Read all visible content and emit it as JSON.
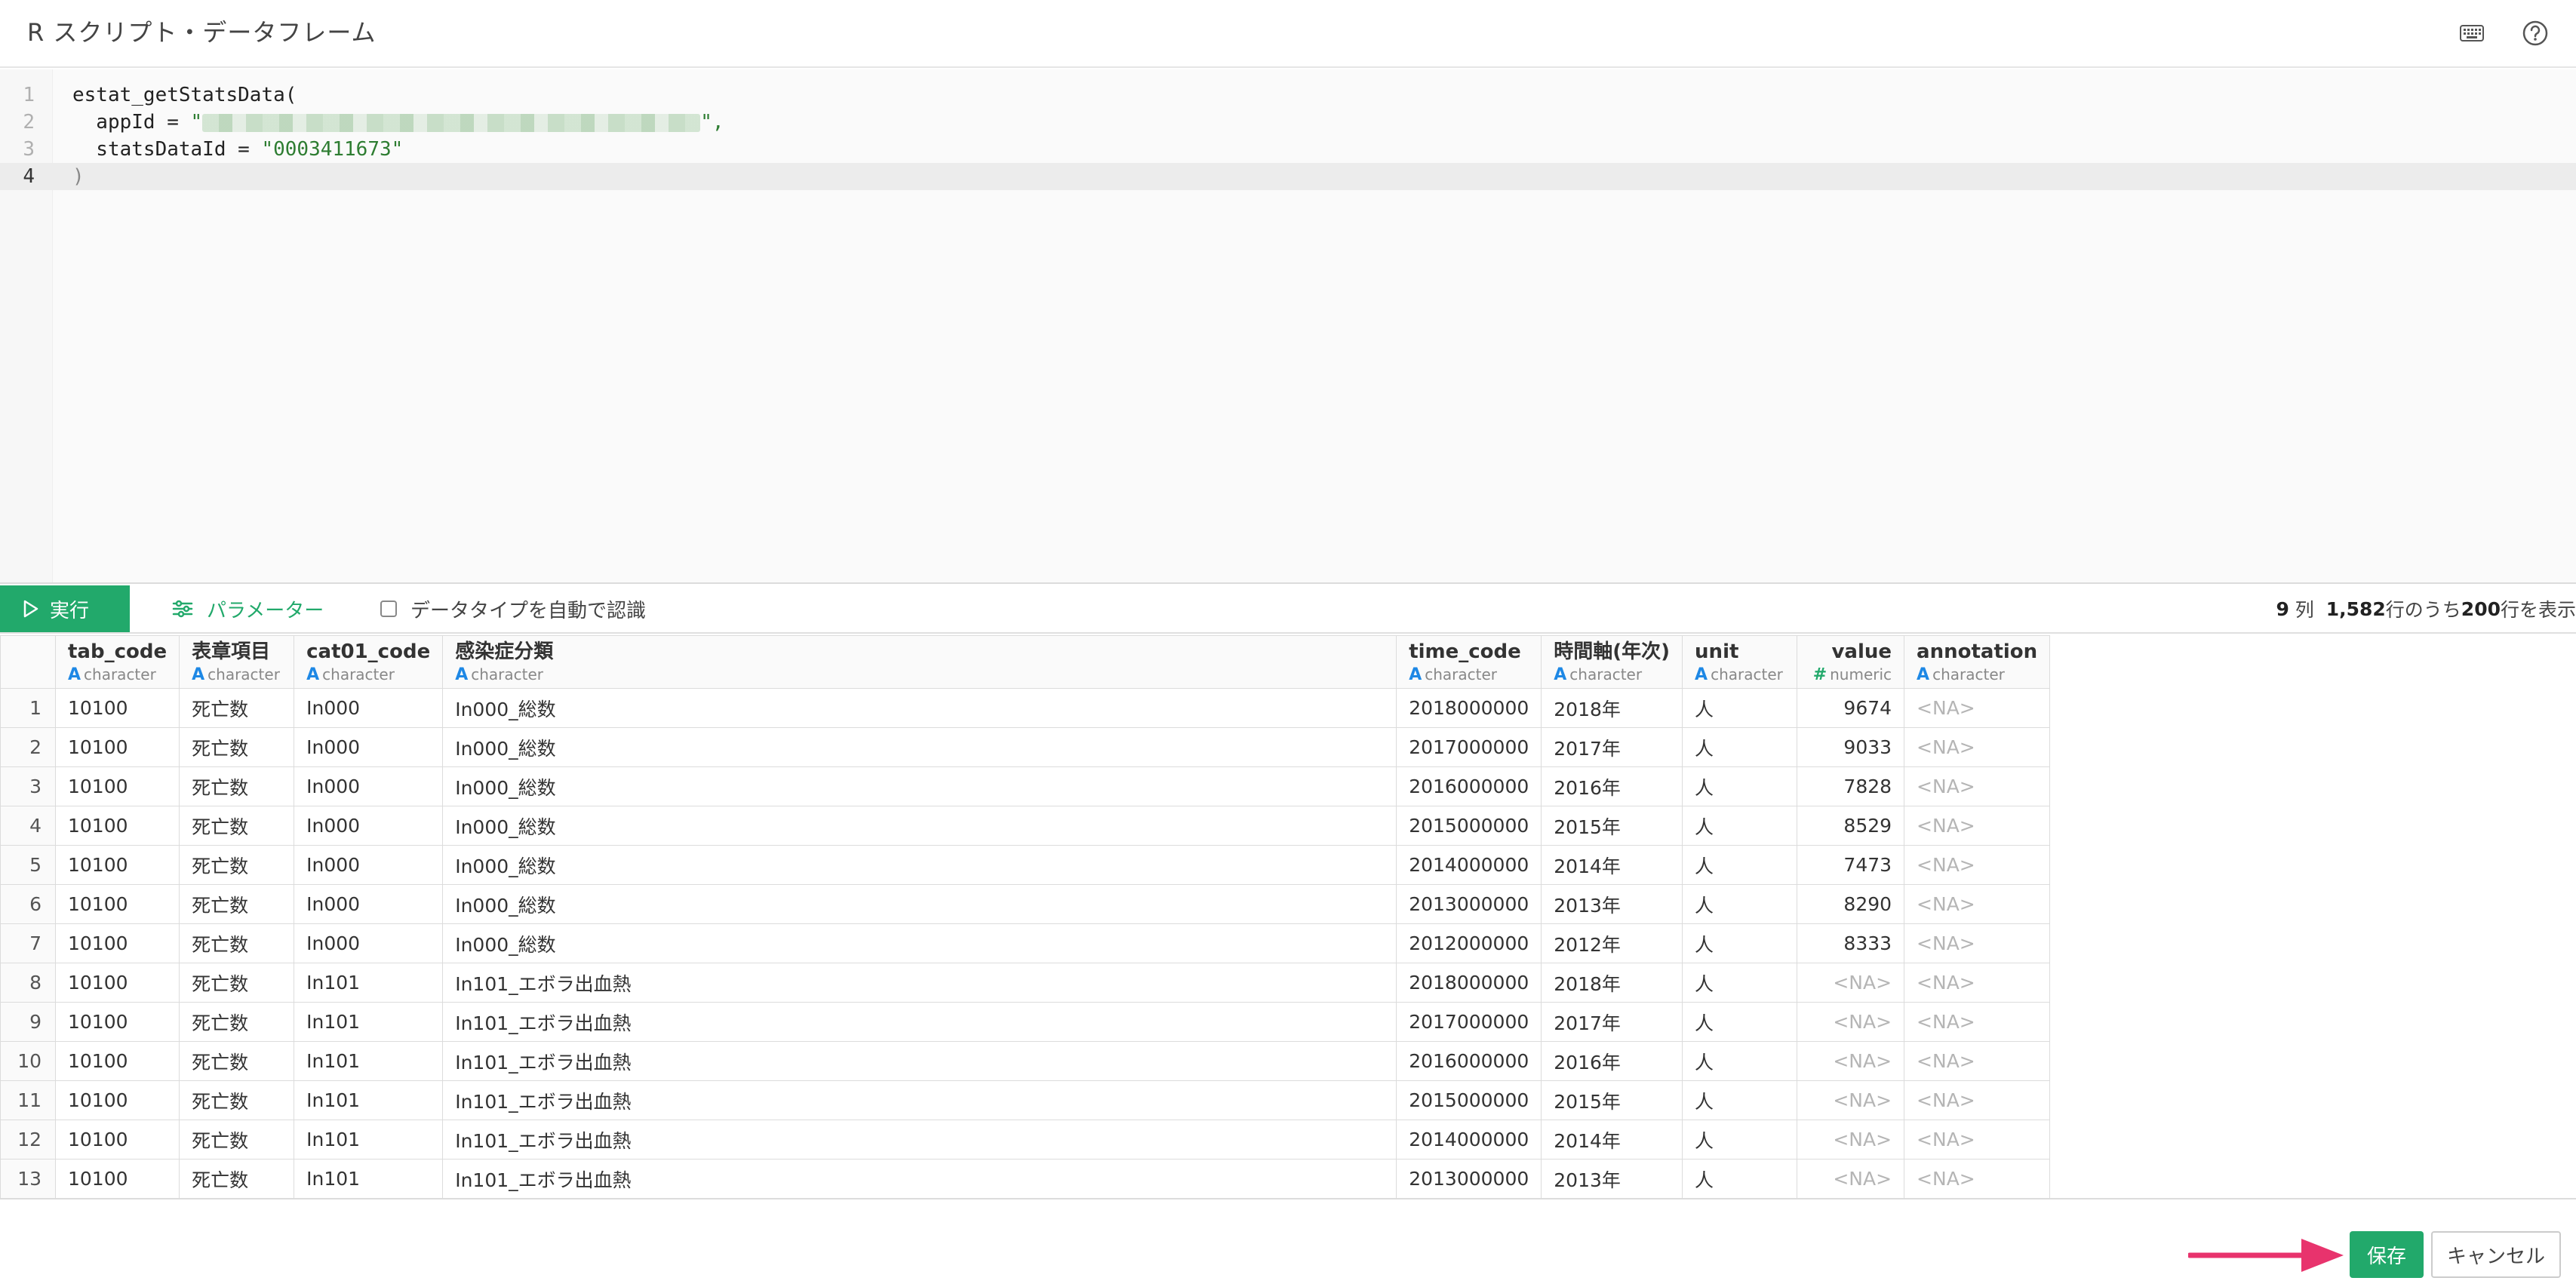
{
  "header": {
    "title": "R スクリプト・データフレーム",
    "keyboard_icon": "keyboard-icon",
    "help_icon": "help-circle-icon"
  },
  "editor": {
    "lines": [
      {
        "num": "1",
        "pre": "estat_getStatsData(",
        "str": "",
        "post": ""
      },
      {
        "num": "2",
        "pre": "  appId = ",
        "str": "\"",
        "post": "\","
      },
      {
        "num": "3",
        "pre": "  statsDataId = ",
        "str": "\"0003411673\"",
        "post": ""
      },
      {
        "num": "4",
        "pre": ")",
        "str": "",
        "post": ""
      }
    ],
    "active_line": 4
  },
  "toolbar": {
    "run_label": "実行",
    "params_label": "パラメーター",
    "auto_type_label": "データタイプを自動で認識",
    "cols_count": "9",
    "cols_unit": " 列  ",
    "total_rows": "1,582",
    "rows_mid": "行のうち",
    "shown_rows": "200",
    "rows_suffix": "行を表示"
  },
  "table": {
    "columns": [
      {
        "name": "tab_code",
        "type": "character",
        "kind": "A"
      },
      {
        "name": "表章項目",
        "type": "character",
        "kind": "A"
      },
      {
        "name": "cat01_code",
        "type": "character",
        "kind": "A"
      },
      {
        "name": "感染症分類",
        "type": "character",
        "kind": "A"
      },
      {
        "name": "time_code",
        "type": "character",
        "kind": "A"
      },
      {
        "name": "時間軸(年次)",
        "type": "character",
        "kind": "A"
      },
      {
        "name": "unit",
        "type": "character",
        "kind": "A"
      },
      {
        "name": "value",
        "type": "numeric",
        "kind": "#"
      },
      {
        "name": "annotation",
        "type": "character",
        "kind": "A"
      }
    ],
    "rows": [
      [
        "1",
        "10100",
        "死亡数",
        "In000",
        "In000_総数",
        "2018000000",
        "2018年",
        "人",
        "9674",
        "<NA>"
      ],
      [
        "2",
        "10100",
        "死亡数",
        "In000",
        "In000_総数",
        "2017000000",
        "2017年",
        "人",
        "9033",
        "<NA>"
      ],
      [
        "3",
        "10100",
        "死亡数",
        "In000",
        "In000_総数",
        "2016000000",
        "2016年",
        "人",
        "7828",
        "<NA>"
      ],
      [
        "4",
        "10100",
        "死亡数",
        "In000",
        "In000_総数",
        "2015000000",
        "2015年",
        "人",
        "8529",
        "<NA>"
      ],
      [
        "5",
        "10100",
        "死亡数",
        "In000",
        "In000_総数",
        "2014000000",
        "2014年",
        "人",
        "7473",
        "<NA>"
      ],
      [
        "6",
        "10100",
        "死亡数",
        "In000",
        "In000_総数",
        "2013000000",
        "2013年",
        "人",
        "8290",
        "<NA>"
      ],
      [
        "7",
        "10100",
        "死亡数",
        "In000",
        "In000_総数",
        "2012000000",
        "2012年",
        "人",
        "8333",
        "<NA>"
      ],
      [
        "8",
        "10100",
        "死亡数",
        "In101",
        "In101_エボラ出血熱",
        "2018000000",
        "2018年",
        "人",
        "<NA>",
        "<NA>"
      ],
      [
        "9",
        "10100",
        "死亡数",
        "In101",
        "In101_エボラ出血熱",
        "2017000000",
        "2017年",
        "人",
        "<NA>",
        "<NA>"
      ],
      [
        "10",
        "10100",
        "死亡数",
        "In101",
        "In101_エボラ出血熱",
        "2016000000",
        "2016年",
        "人",
        "<NA>",
        "<NA>"
      ],
      [
        "11",
        "10100",
        "死亡数",
        "In101",
        "In101_エボラ出血熱",
        "2015000000",
        "2015年",
        "人",
        "<NA>",
        "<NA>"
      ],
      [
        "12",
        "10100",
        "死亡数",
        "In101",
        "In101_エボラ出血熱",
        "2014000000",
        "2014年",
        "人",
        "<NA>",
        "<NA>"
      ],
      [
        "13",
        "10100",
        "死亡数",
        "In101",
        "In101_エボラ出血熱",
        "2013000000",
        "2013年",
        "人",
        "<NA>",
        "<NA>"
      ]
    ]
  },
  "footer": {
    "save_label": "保存",
    "cancel_label": "キャンセル"
  },
  "colors": {
    "accent": "#22a96b",
    "string": "#2e7d32",
    "type_icon": "#1e88e5",
    "annotation_arrow": "#e8336d"
  }
}
